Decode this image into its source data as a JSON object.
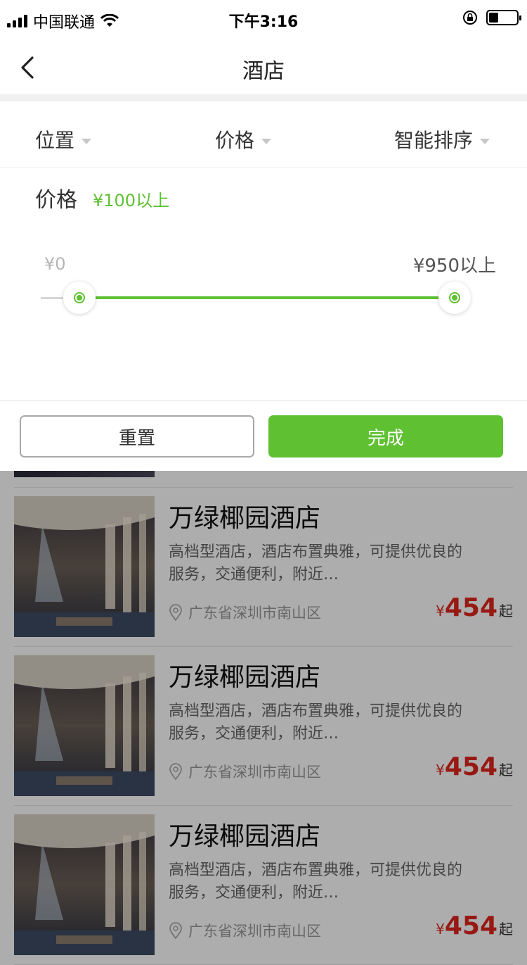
{
  "status_bar": {
    "carrier": "中国联通",
    "time": "下午3:16",
    "battery_level": 0.35
  },
  "nav": {
    "title": "酒店"
  },
  "filters": [
    {
      "label": "位置"
    },
    {
      "label": "价格"
    },
    {
      "label": "智能排序"
    }
  ],
  "price_panel": {
    "title": "价格",
    "selected": "¥100以上",
    "min_label": "¥0",
    "max_label": "¥950以上",
    "range_low_fraction": 0.1,
    "range_high_fraction": 1.0
  },
  "buttons": {
    "reset": "重置",
    "done": "完成"
  },
  "hotels": [
    {
      "name": "万绿椰园酒店",
      "desc": "高档型酒店，酒店布置典雅，可提供优良的服务，交通便利，附近…",
      "location": "广东省深圳市南山区",
      "currency": "¥",
      "price": "454",
      "suffix": "起"
    },
    {
      "name": "万绿椰园酒店",
      "desc": "高档型酒店，酒店布置典雅，可提供优良的服务，交通便利，附近…",
      "location": "广东省深圳市南山区",
      "currency": "¥",
      "price": "454",
      "suffix": "起"
    },
    {
      "name": "万绿椰园酒店",
      "desc": "高档型酒店，酒店布置典雅，可提供优良的服务，交通便利，附近…",
      "location": "广东省深圳市南山区",
      "currency": "¥",
      "price": "454",
      "suffix": "起"
    }
  ],
  "colors": {
    "accent": "#5fc132",
    "price": "#e0261c",
    "overlay": "rgba(0,0,0,0.32)"
  }
}
